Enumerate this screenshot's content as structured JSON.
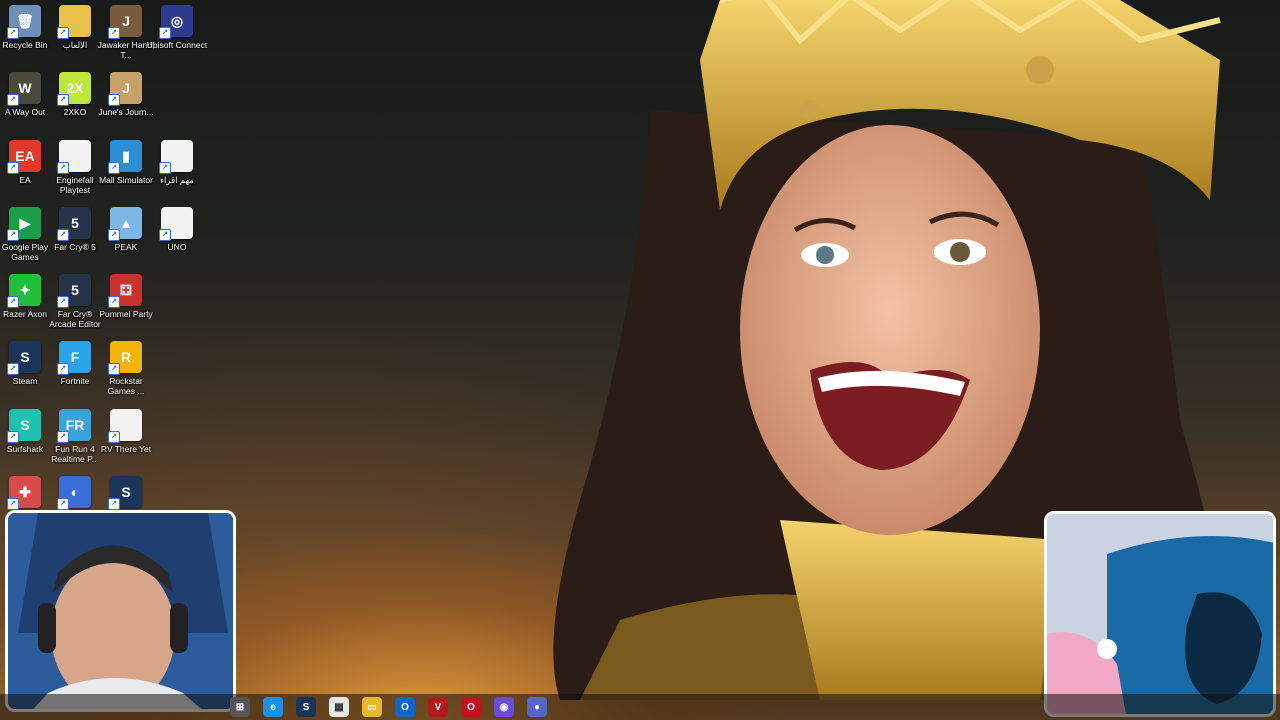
{
  "desktop": {
    "icons": [
      {
        "label": "Recycle Bin",
        "glyph": "🗑",
        "color": "#6d8fb8"
      },
      {
        "label": "الالعاب",
        "glyph": "",
        "color": "#e8c04a"
      },
      {
        "label": "Jawaker Hand, T...",
        "glyph": "J",
        "color": "#7a5b3e"
      },
      {
        "label": "Ubisoft Connect",
        "glyph": "◎",
        "color": "#2f3b8f"
      },
      {
        "label": "A Way Out",
        "glyph": "W",
        "color": "#4a4a3c"
      },
      {
        "label": "2XKO",
        "glyph": "2X",
        "color": "#bfe63b"
      },
      {
        "label": "June's Journ...",
        "glyph": "J",
        "color": "#c6a16a"
      },
      {
        "label": "EA",
        "glyph": "EA",
        "color": "#e0382b"
      },
      {
        "label": "Enginefall Playtest",
        "glyph": "",
        "color": "#f2f2f2"
      },
      {
        "label": "Mall Simulator",
        "glyph": "▮",
        "color": "#2c8fd6"
      },
      {
        "label": "مهم اقراء",
        "glyph": "",
        "color": "#f2f2f2"
      },
      {
        "label": "Google Play Games",
        "glyph": "▶",
        "color": "#1b9e4b"
      },
      {
        "label": "Far Cry® 5",
        "glyph": "5",
        "color": "#27334a"
      },
      {
        "label": "PEAK",
        "glyph": "▲",
        "color": "#7cb7e6"
      },
      {
        "label": "UNO",
        "glyph": "",
        "color": "#f2f2f2"
      },
      {
        "label": "Razer Axon",
        "glyph": "✦",
        "color": "#1fbf3a"
      },
      {
        "label": "Far Cry® Arcade Editor",
        "glyph": "5",
        "color": "#27334a"
      },
      {
        "label": "Pummel Party",
        "glyph": "⚃",
        "color": "#c8322f"
      },
      {
        "label": "Steam",
        "glyph": "S",
        "color": "#1b3558"
      },
      {
        "label": "Fortnite",
        "glyph": "F",
        "color": "#2aa3e8"
      },
      {
        "label": "Rockstar Games ...",
        "glyph": "R",
        "color": "#f4b400"
      },
      {
        "label": "Surfshark",
        "glyph": "S",
        "color": "#1ec2b0"
      },
      {
        "label": "Fun Run 4 Realtime P...",
        "glyph": "FR",
        "color": "#3aa3d9"
      },
      {
        "label": "RV There Yet",
        "glyph": "",
        "color": "#f2f2f2"
      },
      {
        "label": "",
        "glyph": "✚",
        "color": "#d84b4b"
      },
      {
        "label": "",
        "glyph": "◐",
        "color": "#3b6ed8"
      },
      {
        "label": "",
        "glyph": "S",
        "color": "#1b3558"
      }
    ]
  },
  "taskbar": {
    "icons": [
      {
        "name": "task-view-icon",
        "glyph": "⊞",
        "color": "#555"
      },
      {
        "name": "edge-icon",
        "glyph": "e",
        "color": "#1a8fe3"
      },
      {
        "name": "steam-icon",
        "glyph": "S",
        "color": "#1b3558"
      },
      {
        "name": "calculator-icon",
        "glyph": "▦",
        "color": "#e7e7e7"
      },
      {
        "name": "file-explorer-icon",
        "glyph": "▭",
        "color": "#e9b831"
      },
      {
        "name": "outlook-icon",
        "glyph": "O",
        "color": "#1167c9"
      },
      {
        "name": "voicemeeter-icon",
        "glyph": "V",
        "color": "#b01c1c"
      },
      {
        "name": "opera-icon",
        "glyph": "O",
        "color": "#c4121f"
      },
      {
        "name": "discord-app-icon",
        "glyph": "◉",
        "color": "#6a4be0"
      },
      {
        "name": "app-icon",
        "glyph": "●",
        "color": "#5466c8"
      }
    ]
  }
}
